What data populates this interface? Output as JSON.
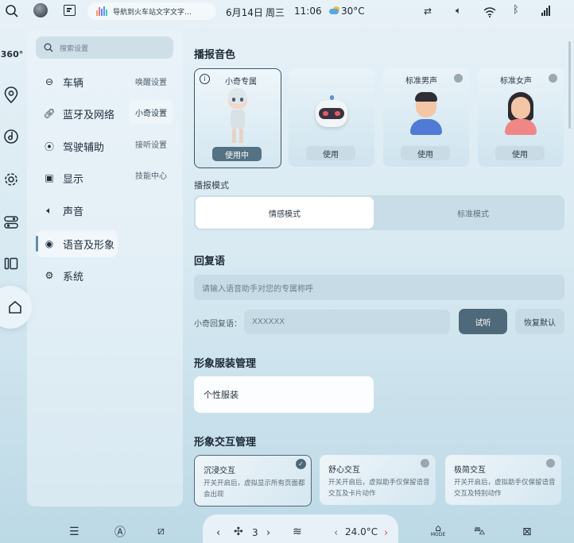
{
  "status_bar": {
    "media_title": "导航到火车站文字文字…",
    "date": "6月14日",
    "weekday": "周三",
    "time": "11:06",
    "temperature": "30°C"
  },
  "rail": {
    "view360_label": "360°"
  },
  "menu": {
    "search_placeholder": "搜索设置",
    "items": [
      {
        "label": "车辆",
        "icon": "car-icon"
      },
      {
        "label": "蓝牙及网络",
        "icon": "link-icon"
      },
      {
        "label": "驾驶辅助",
        "icon": "drive-assist-icon"
      },
      {
        "label": "显示",
        "icon": "display-icon"
      },
      {
        "label": "声音",
        "icon": "speaker-icon"
      },
      {
        "label": "语音及形象",
        "icon": "voice-icon",
        "active": true
      },
      {
        "label": "系统",
        "icon": "gear-icon"
      }
    ],
    "sub_items": [
      {
        "label": "唤醒设置"
      },
      {
        "label": "小奇设置",
        "active": true
      },
      {
        "label": "接听设置"
      },
      {
        "label": "技能中心"
      }
    ]
  },
  "broadcast_voice": {
    "title": "播报音色",
    "cards": [
      {
        "name": "小奇专属",
        "button": "使用中",
        "selected": true
      },
      {
        "name": "",
        "button": "使用"
      },
      {
        "name": "标准男声",
        "button": "使用"
      },
      {
        "name": "标准女声",
        "button": "使用"
      }
    ]
  },
  "broadcast_mode": {
    "title": "播报模式",
    "options": [
      "情感模式",
      "标准模式"
    ],
    "selected": "情感模式"
  },
  "reply": {
    "title": "回复语",
    "nickname_placeholder": "请输入语音助手对您的专属称呼",
    "reply_label": "小奇回复语：",
    "reply_placeholder": "XXXXXX",
    "listen_button": "试听",
    "restore_button": "恢复默认"
  },
  "outfit": {
    "title": "形象服装管理",
    "item_label": "个性服装"
  },
  "interaction": {
    "title": "形象交互管理",
    "cards": [
      {
        "title": "沉浸交互",
        "desc": "开关开启后，虚拟显示所有页面都会出现",
        "selected": true
      },
      {
        "title": "舒心交互",
        "desc": "开关开启后，虚拟助手仅保留语音交互及卡片动作"
      },
      {
        "title": "极简交互",
        "desc": "开关开启后，虚拟助手仅保留语音交互及特别动作"
      }
    ]
  },
  "dock": {
    "fan_level": "3",
    "ac_temperature": "24.0°C",
    "mode_label": "MODE"
  }
}
